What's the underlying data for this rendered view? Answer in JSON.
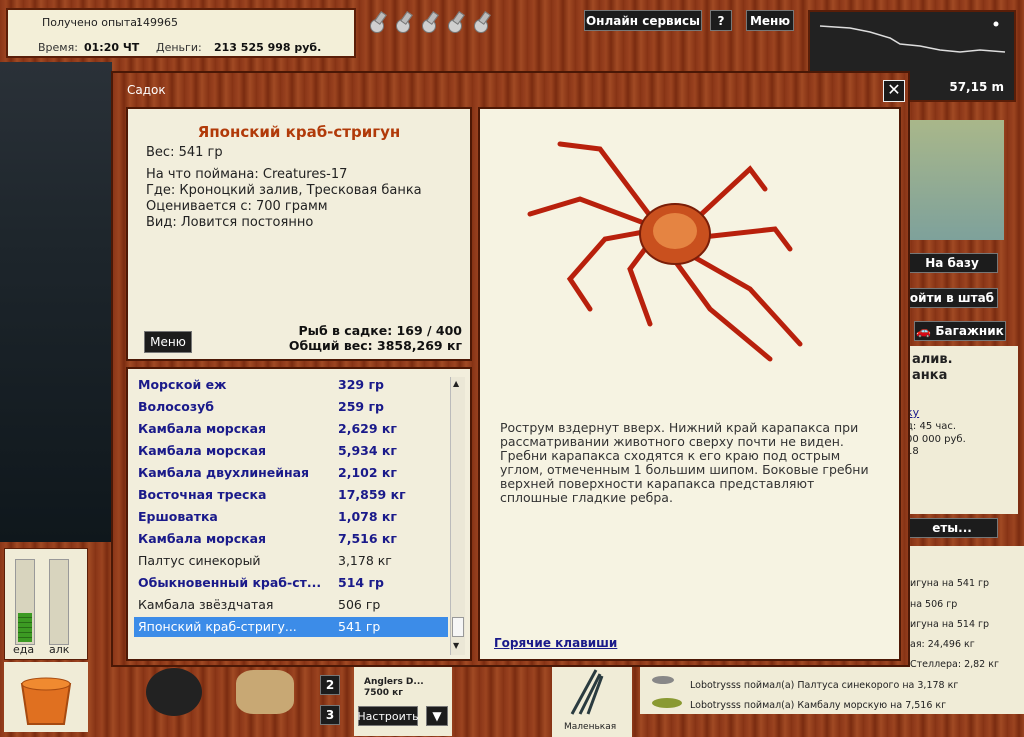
{
  "topbar": {
    "exp_label": "Получено опыта:",
    "exp_value": "149965",
    "time_label": "Время:",
    "time_value": "01:20 ЧТ",
    "money_label": "Деньги:",
    "money_value": "213 525 998 руб.",
    "online_services": "Онлайн сервисы",
    "help": "?",
    "menu": "Меню"
  },
  "map": {
    "depth": "57,15 m"
  },
  "dialog": {
    "title": "Садок",
    "close": "✕",
    "fish": {
      "name": "Японский краб-стригун",
      "weight": "Вес: 541 гр",
      "bait": "На что поймана: Creatures-17",
      "location": "Где: Кроноцкий залив, Тресковая банка",
      "min_weight": "Оценивается с: 700 грамм",
      "type": "Вид: Ловится постоянно"
    },
    "menu_button": "Меню",
    "fish_count": "Рыб в садке: 169 / 400",
    "total_weight": "Общий вес: 3858,269 кг",
    "list": [
      {
        "name": "Морской еж",
        "weight": "329 гр",
        "bold": true
      },
      {
        "name": "Волосозуб",
        "weight": "259 гр",
        "bold": true
      },
      {
        "name": "Камбала морская",
        "weight": "2,629 кг",
        "bold": true
      },
      {
        "name": "Камбала морская",
        "weight": "5,934 кг",
        "bold": true
      },
      {
        "name": "Камбала двухлинейная",
        "weight": "2,102 кг",
        "bold": true
      },
      {
        "name": "Восточная треска",
        "weight": "17,859 кг",
        "bold": true
      },
      {
        "name": "Ершоватка",
        "weight": "1,078 кг",
        "bold": true
      },
      {
        "name": "Камбала морская",
        "weight": "7,516 кг",
        "bold": true
      },
      {
        "name": "Палтус синекорый",
        "weight": "3,178 кг",
        "bold": false
      },
      {
        "name": "Обыкновенный краб-ст...",
        "weight": "514 гр",
        "bold": true
      },
      {
        "name": "Камбала звёздчатая",
        "weight": "506 гр",
        "bold": false
      },
      {
        "name": "Японский краб-стригу...",
        "weight": "541 гр",
        "bold": false,
        "selected": true
      }
    ],
    "description": "Рострум вздернут вверх. Нижний край карапакса при рассматривании животного сверху почти не виден. Гребни карапакса сходятся к его краю под острым углом, отмеченным 1 большим шипом. Боковые гребни верхней поверхности карапакса представляют сплошные гладкие ребра.",
    "hotkeys": "Горячие клавиши"
  },
  "right_panel": {
    "to_base": "На базу",
    "to_hq": "ойти в штаб",
    "trunk": "Багажник",
    "loc_line1": "алив.",
    "loc_line2": "анка",
    "link": "ку",
    "info1": "д: 45 час.",
    "info2": "00 000 руб.",
    "info3": "18",
    "more": "еты..."
  },
  "feed": [
    "игуна на 541 гр",
    "на 506 гр",
    "игуна на 514 гр",
    "ая: 24,496 кг",
    " Стеллера: 2,82 кг",
    "Lobotrysss поймал(а) Палтуса синекорого на 3,178 кг",
    "Lobotrysss поймал(а) Камбалу морскую на 7,516 кг"
  ],
  "bottom": {
    "food": "еда",
    "alc": "алк",
    "num2": "2",
    "num3": "3",
    "anglers_name": "Anglers D...",
    "anglers_weight": "7500 кг",
    "setup": "Настроить",
    "lure_label": "Маленькая",
    "food_level": 0.35,
    "alc_level": 0.0
  }
}
